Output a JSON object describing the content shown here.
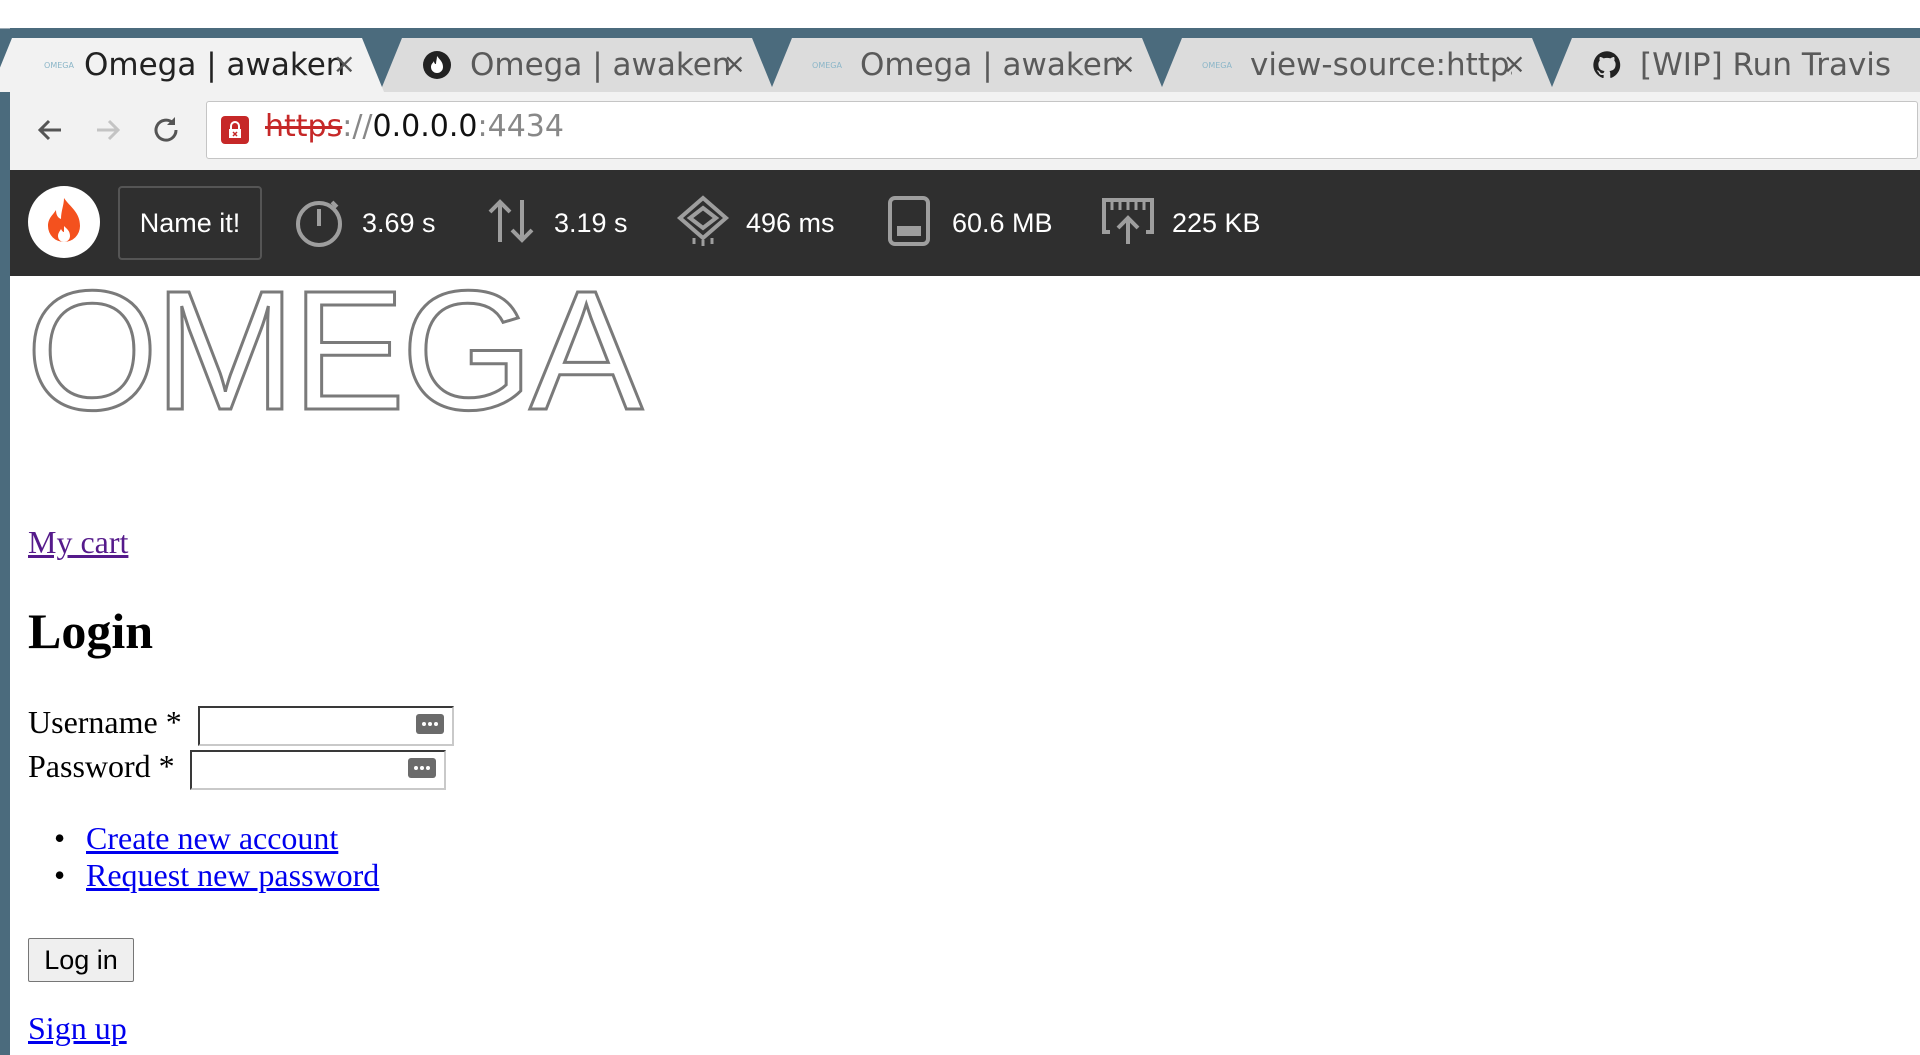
{
  "browser": {
    "tabs": [
      {
        "title": "Omega | awakenin",
        "favicon": "omega-logo-icon",
        "active": true
      },
      {
        "title": "Omega | awakenin",
        "favicon": "flame-icon",
        "active": false
      },
      {
        "title": "Omega | awakenin",
        "favicon": "omega-logo-icon",
        "active": false
      },
      {
        "title": "view-source:https:",
        "favicon": "omega-logo-icon",
        "active": false
      },
      {
        "title": "[WIP] Run Travis C",
        "favicon": "github-icon",
        "active": false
      }
    ],
    "tab_close": "×",
    "favicon_text": "OMEGA",
    "address": {
      "scheme": "https",
      "separator": "://",
      "host": "0.0.0.0",
      "port": ":4434"
    }
  },
  "devbar": {
    "name_button": "Name it!",
    "metrics": [
      {
        "icon": "stopwatch-icon",
        "value": "3.69 s"
      },
      {
        "icon": "up-down-arrows-icon",
        "value": "3.19 s"
      },
      {
        "icon": "cpu-chip-icon",
        "value": "496 ms"
      },
      {
        "icon": "memory-icon",
        "value": "60.6 MB"
      },
      {
        "icon": "network-upload-icon",
        "value": "225 KB"
      }
    ]
  },
  "page": {
    "brand": "OMEGA",
    "my_cart": "My cart",
    "heading": "Login",
    "username_label": "Username *",
    "password_label": "Password *",
    "username_value": "",
    "password_value": "",
    "links": [
      "Create new account",
      "Request new password"
    ],
    "login_button": "Log in",
    "signup": "Sign up"
  },
  "colors": {
    "tabstrip": "#4b6b7d",
    "devbar": "#2f2f2f",
    "insecure": "#c62828",
    "link": "#0000ee",
    "visited_link": "#551a8b"
  }
}
